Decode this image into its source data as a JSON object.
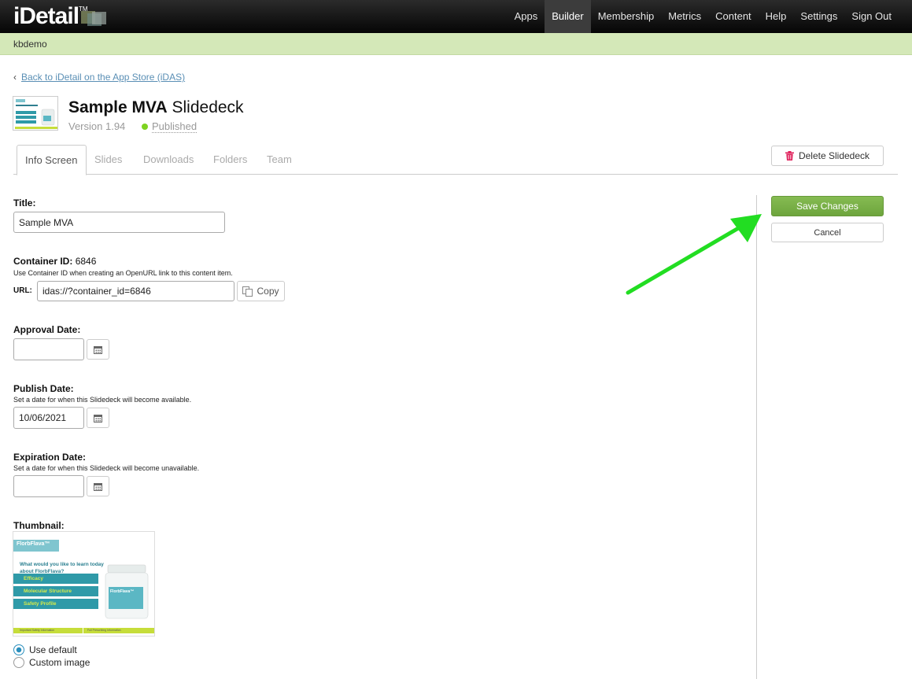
{
  "app": {
    "logo": "iDetail",
    "logo_tm": "TM"
  },
  "nav": {
    "items": [
      "Apps",
      "Builder",
      "Membership",
      "Metrics",
      "Content",
      "Help",
      "Settings",
      "Sign Out"
    ],
    "active": "Builder"
  },
  "account": {
    "name": "kbdemo"
  },
  "back_link": {
    "chevron": "‹",
    "label": "Back to iDetail on the App Store (iDAS)"
  },
  "deck": {
    "title_bold": "Sample MVA",
    "title_light": "Slidedeck",
    "version": "Version 1.94",
    "status": "Published",
    "status_color": "#7ed321"
  },
  "tabs": {
    "items": [
      "Info Screen",
      "Slides",
      "Downloads",
      "Folders",
      "Team"
    ],
    "active": "Info Screen"
  },
  "actions": {
    "delete": "Delete Slidedeck",
    "save": "Save Changes",
    "cancel": "Cancel",
    "save_color": "#7ab248"
  },
  "form": {
    "title_label": "Title:",
    "title_value": "Sample MVA",
    "container_label": "Container ID:",
    "container_id": "6846",
    "container_help": "Use Container ID when creating an OpenURL link to this content item.",
    "url_label": "URL:",
    "url_value": "idas://?container_id=6846",
    "copy_label": "Copy",
    "approval_label": "Approval Date:",
    "approval_value": "",
    "publish_label": "Publish Date:",
    "publish_help": "Set a date for when this Slidedeck will become available.",
    "publish_value": "10/06/2021",
    "expiration_label": "Expiration Date:",
    "expiration_help": "Set a date for when this Slidedeck will become unavailable.",
    "expiration_value": "",
    "thumbnail_label": "Thumbnail:",
    "thumb_options": [
      "Use default",
      "Custom image"
    ],
    "thumb_selected": "Use default"
  },
  "thumbnail_preview": {
    "brand": "FlorbFlava™",
    "question": "What would you like to learn today about FlorbFlava?",
    "menu": [
      "Efficacy",
      "Molecular Structure",
      "Safety Profile"
    ],
    "bottle_brand": "FlorbFlava™",
    "footer": [
      "Important Safety Information",
      "Full Prescribing Information"
    ]
  },
  "annotation": {
    "arrow_color": "#22dd22"
  }
}
